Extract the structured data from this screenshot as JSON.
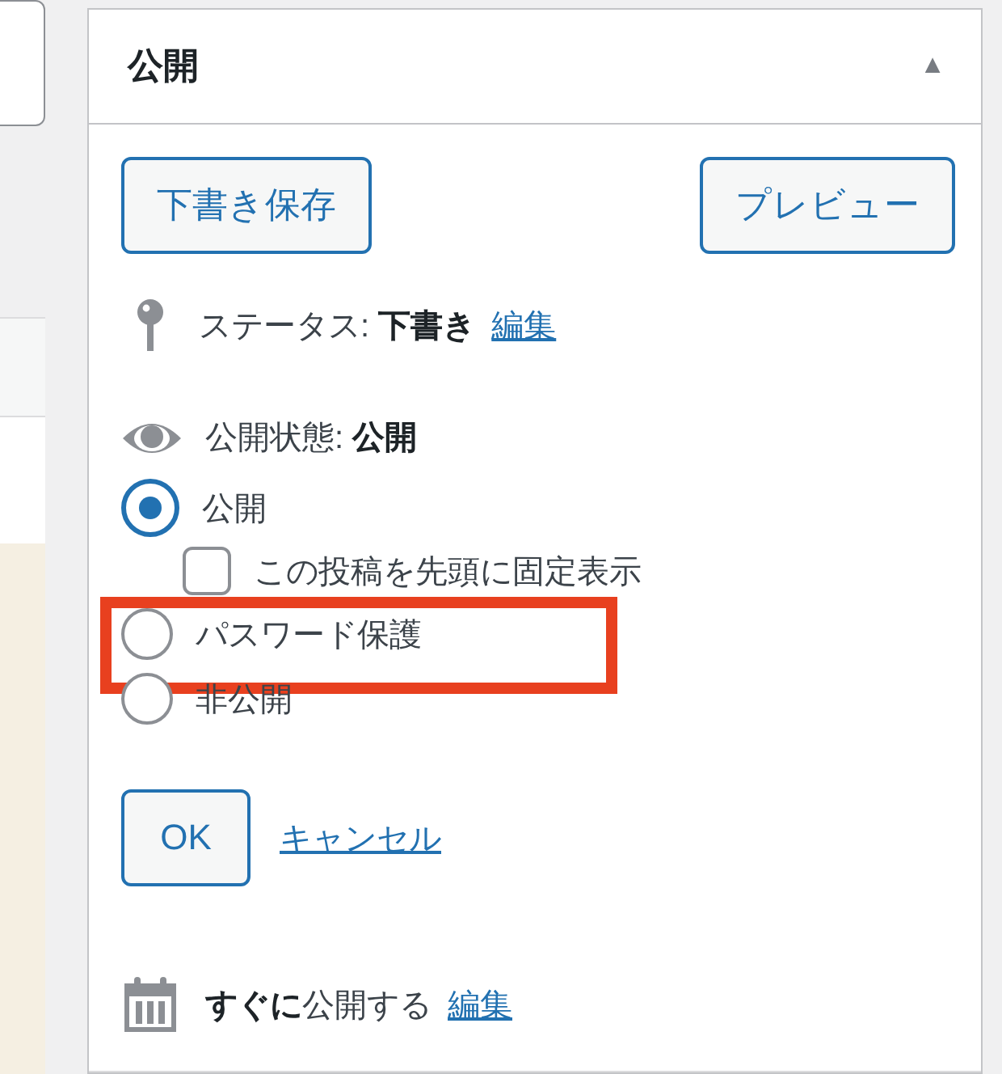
{
  "panel": {
    "title": "公開",
    "collapse_glyph": "▲"
  },
  "buttons": [
    {
      "label": "下書き保存"
    },
    {
      "label": "プレビュー"
    }
  ],
  "status": {
    "text": "ステータス: **下書き**",
    "edit_link": "編集"
  },
  "visibility": {
    "text": "公開状態: **公開**",
    "options": [
      {
        "kind": "radio",
        "label": "公開",
        "selected": true,
        "highlighted": false
      },
      {
        "kind": "checkbox",
        "label": "この投稿を先頭に固定表示",
        "checked": false,
        "highlighted": false
      },
      {
        "kind": "radio",
        "label": "パスワード保護",
        "selected": false,
        "highlighted": true
      },
      {
        "kind": "radio",
        "label": "非公開",
        "selected": false,
        "highlighted": false
      }
    ]
  },
  "actions": {
    "ok": "OK",
    "cancel": "キャンセル"
  },
  "schedule": {
    "text": "**すぐに**公開する",
    "edit_link": "編集"
  }
}
